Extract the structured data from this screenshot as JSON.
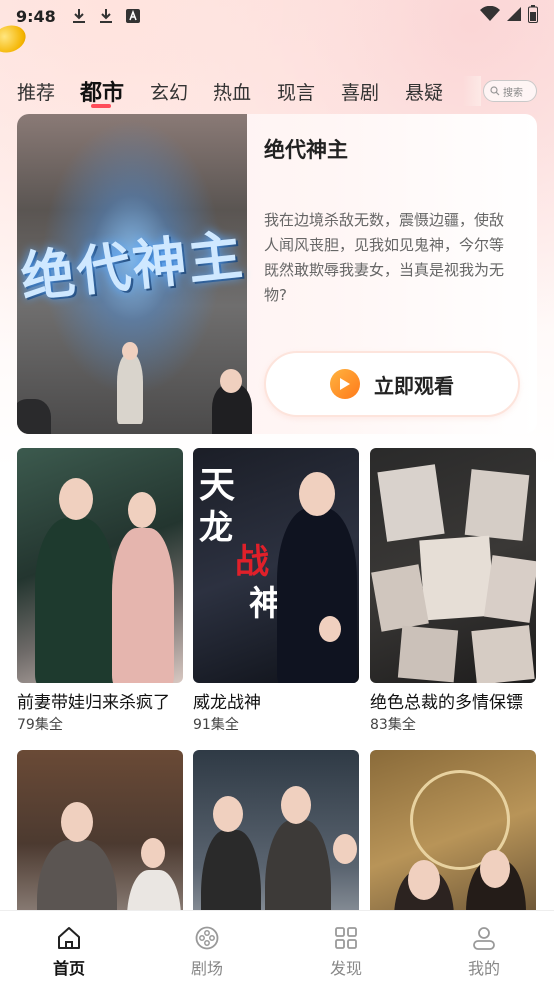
{
  "status_bar": {
    "time": "9:48"
  },
  "tabs": [
    {
      "label": "推荐"
    },
    {
      "label": "都市"
    },
    {
      "label": "玄幻"
    },
    {
      "label": "热血"
    },
    {
      "label": "现言"
    },
    {
      "label": "喜剧"
    },
    {
      "label": "悬疑"
    }
  ],
  "active_tab": "都市",
  "search": {
    "placeholder": "搜索"
  },
  "featured": {
    "title": "绝代神主",
    "description": "我在边境杀敌无数，震慑边疆，使敌人闻风丧胆，见我如见鬼神，今尔等既然敢欺辱我妻女，当真是视我为无物?",
    "watch_label": "立即观看",
    "poster_text": "绝代神主"
  },
  "dramas": [
    {
      "title": "前妻带娃归来杀疯了",
      "episodes": "79集全"
    },
    {
      "title": "威龙战神",
      "episodes": "91集全",
      "poster_text": [
        "天",
        "龙",
        "战",
        "神"
      ]
    },
    {
      "title": "绝色总裁的多情保镖",
      "episodes": "83集全"
    },
    {
      "title": "",
      "episodes": ""
    },
    {
      "title": "",
      "episodes": ""
    },
    {
      "title": "",
      "episodes": ""
    }
  ],
  "bottom_nav": [
    {
      "label": "首页",
      "icon": "home-icon",
      "active": true
    },
    {
      "label": "剧场",
      "icon": "film-reel-icon",
      "active": false
    },
    {
      "label": "发现",
      "icon": "grid-icon",
      "active": false
    },
    {
      "label": "我的",
      "icon": "user-icon",
      "active": false
    }
  ],
  "colors": {
    "accent": "#ff4d5a",
    "play_button": "#ff8a1f",
    "active_nav": "#111111",
    "inactive_nav": "#888888"
  }
}
